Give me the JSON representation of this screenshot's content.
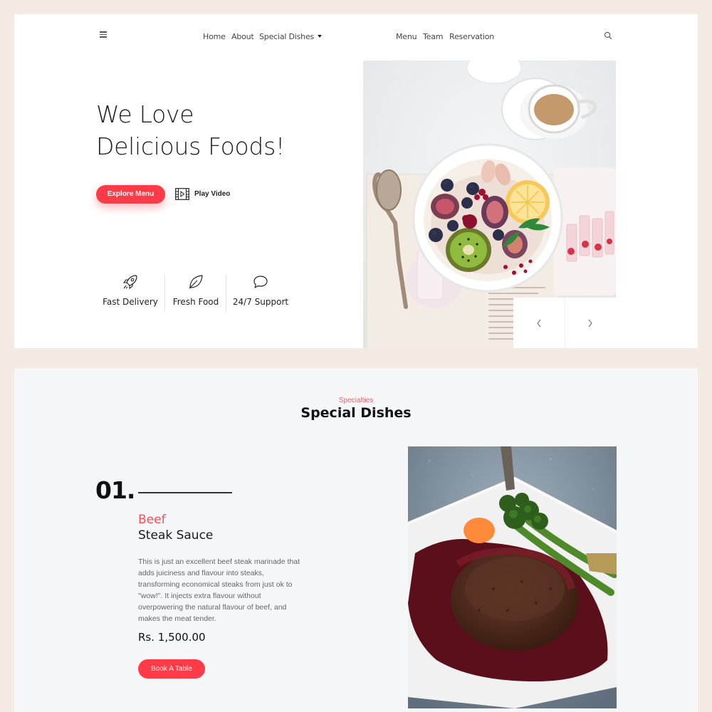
{
  "nav": {
    "links": [
      "Home",
      "About",
      "Special Dishes",
      "Menu",
      "Team",
      "Reservation"
    ]
  },
  "hero": {
    "title_line1": "We Love",
    "title_line2": "Delicious Foods!",
    "explore_label": "Explore Menu",
    "play_label": "Play Video",
    "features": [
      "Fast Delivery",
      "Fresh Food",
      "24/7 Support"
    ]
  },
  "specials": {
    "subtitle": "Specialties",
    "title": "Special Dishes",
    "number": "01.",
    "category": "Beef",
    "name": "Steak Sauce",
    "description_lines": [
      "This is just an excellent beef steak marinade that",
      "adds juiciness and flavour into steaks,",
      "transforming economical steaks from just ok to",
      "\"wow!\". It injects extra flavour without",
      "overpowering the natural flavour of beef, and",
      "makes the meat tender."
    ],
    "price": "Rs. 1,500.00",
    "book_label": "Book A Table"
  },
  "colors": {
    "accent": "#ff3b47",
    "page_bg": "#f3ebe2",
    "section_bg": "#f5f6f8"
  },
  "icons": [
    "menu-icon",
    "search-icon",
    "caret-down-icon",
    "video-icon",
    "rocket-icon",
    "leaf-icon",
    "chat-icon",
    "chevron-left-icon",
    "chevron-right-icon"
  ]
}
